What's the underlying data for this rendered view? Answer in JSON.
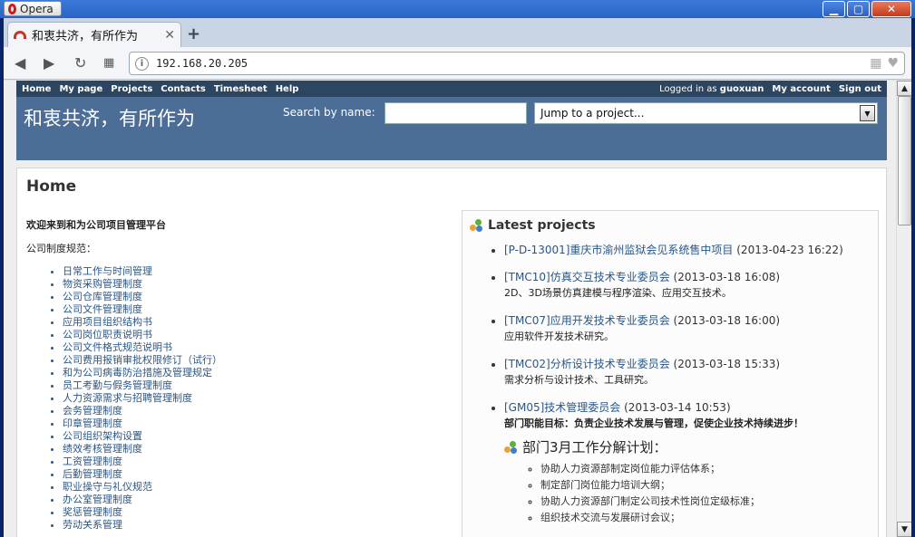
{
  "browser": {
    "app_name": "Opera",
    "tab_title": "和衷共济，有所作为",
    "url": "192.168.20.205"
  },
  "top_menu": {
    "left": [
      "Home",
      "My page",
      "Projects",
      "Contacts",
      "Timesheet",
      "Help"
    ],
    "logged_prefix": "Logged in as",
    "user": "guoxuan",
    "my_account": "My account",
    "sign_out": "Sign out"
  },
  "header": {
    "site_title": "和衷共济，有所作为",
    "search_label": "Search by name:",
    "jump_label": "Jump to a project..."
  },
  "main": {
    "title": "Home",
    "welcome": "欢迎来到和为公司项目管理平台",
    "rules_title": "公司制度规范：",
    "rules": [
      "日常工作与时间管理",
      "物资采购管理制度",
      "公司仓库管理制度",
      "公司文件管理制度",
      "应用项目组织结构书",
      "公司岗位职责说明书",
      "公司文件格式规范说明书",
      "公司费用报销审批权限修订（试行）",
      "和为公司病毒防治措施及管理规定",
      "员工考勤与假务管理制度",
      "人力资源需求与招聘管理制度",
      "会务管理制度",
      "印章管理制度",
      "公司组织架构设置",
      "绩效考核管理制度",
      "工资管理制度",
      "后勤管理制度",
      "职业操守与礼仪规范",
      "办公室管理制度",
      "奖惩管理制度",
      "劳动关系管理"
    ]
  },
  "latest_projects": {
    "title": "Latest projects",
    "items": [
      {
        "name": "[P-D-13001]重庆市渝州监狱会见系统售中项目",
        "date": "(2013-04-23 16:22)",
        "desc": ""
      },
      {
        "name": "[TMC10]仿真交互技术专业委员会",
        "date": "(2013-03-18 16:08)",
        "desc": "2D、3D场景仿真建模与程序渲染、应用交互技术。"
      },
      {
        "name": "[TMC07]应用开发技术专业委员会",
        "date": "(2013-03-18 16:00)",
        "desc": "应用软件开发技术研究。"
      },
      {
        "name": "[TMC02]分析设计技术专业委员会",
        "date": "(2013-03-18 15:33)",
        "desc": "需求分析与设计技术、工具研究。"
      },
      {
        "name": "[GM05]技术管理委员会",
        "date": "(2013-03-14 10:53)",
        "desc": "部门职能目标：负责企业技术发展与管理，促使企业技术持续进步！"
      }
    ],
    "plan_title": "部门3月工作分解计划：",
    "plan_items": [
      "协助人力资源部制定岗位能力评估体系；",
      "制定部门岗位能力培训大纲；",
      "协助人力资源部门制定公司技术性岗位定级标准；",
      "组织技术交流与发展研讨会议；"
    ]
  }
}
